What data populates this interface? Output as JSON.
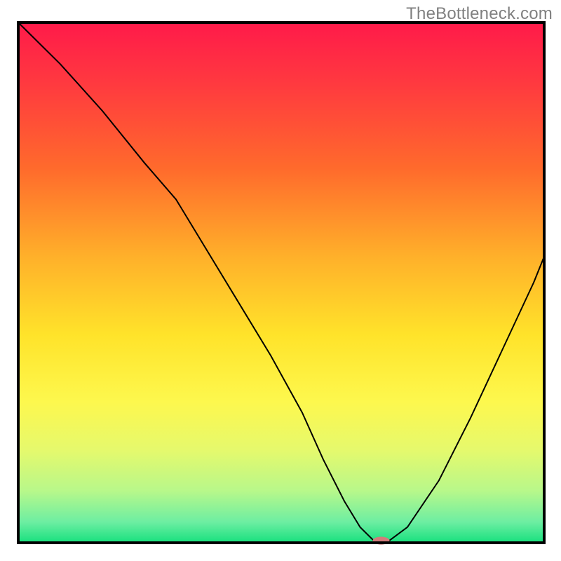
{
  "watermark": "TheBottleneck.com",
  "chart_data": {
    "type": "line",
    "title": "",
    "xlabel": "",
    "ylabel": "",
    "xlim": [
      0,
      100
    ],
    "ylim": [
      0,
      100
    ],
    "grid": false,
    "legend": null,
    "gradient": {
      "stops": [
        {
          "offset": 0.0,
          "color": "#ff1a4a"
        },
        {
          "offset": 0.12,
          "color": "#ff3a3f"
        },
        {
          "offset": 0.28,
          "color": "#ff6a2c"
        },
        {
          "offset": 0.45,
          "color": "#ffb02a"
        },
        {
          "offset": 0.6,
          "color": "#ffe32a"
        },
        {
          "offset": 0.73,
          "color": "#fdf84e"
        },
        {
          "offset": 0.82,
          "color": "#e6f96c"
        },
        {
          "offset": 0.9,
          "color": "#b8f88a"
        },
        {
          "offset": 0.96,
          "color": "#6deea2"
        },
        {
          "offset": 1.0,
          "color": "#17e07e"
        }
      ]
    },
    "frame_color": "#000000",
    "series": [
      {
        "name": "bottleneck-curve",
        "color": "#000000",
        "stroke_width": 2,
        "x": [
          0,
          8,
          16,
          24,
          30,
          36,
          42,
          48,
          54,
          58,
          62,
          65,
          67,
          68,
          70,
          74,
          80,
          86,
          92,
          98,
          100
        ],
        "y": [
          100,
          92,
          83,
          73,
          66,
          56,
          46,
          36,
          25,
          16,
          8,
          3,
          1,
          0,
          0,
          3,
          12,
          24,
          37,
          50,
          55
        ]
      }
    ],
    "marker": {
      "name": "optimum-marker",
      "x": 69,
      "y": 0.4,
      "color": "#d37b7b",
      "rx": 1.6,
      "ry": 0.75
    }
  }
}
